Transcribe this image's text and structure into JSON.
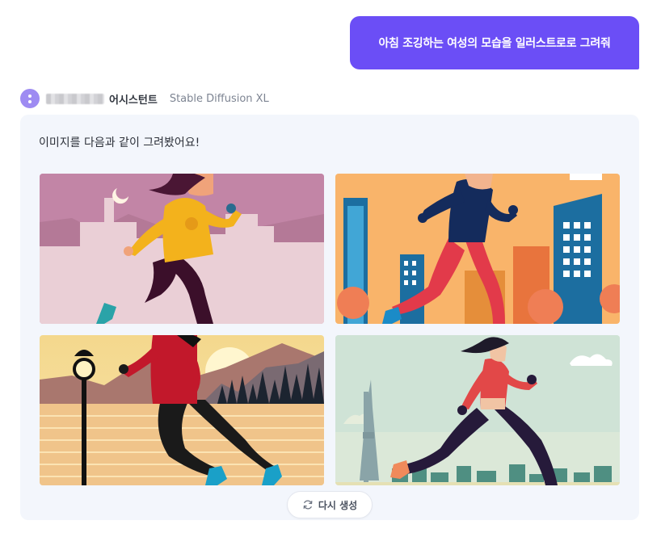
{
  "user_message": "아침 조깅하는 여성의 모습을 일러스트로로 그려줘",
  "assistant": {
    "name": "어시스턴트",
    "model": "Stable Diffusion XL",
    "avatar_icon": "assistant-avatar-icon"
  },
  "answer": {
    "text": "이미지를 다음과 같이 그려봤어요!",
    "images": [
      {
        "icon": "woman-jogging-night-city-illustration"
      },
      {
        "icon": "woman-jogging-city-autumn-illustration"
      },
      {
        "icon": "woman-jogging-lakeside-sunrise-illustration"
      },
      {
        "icon": "woman-jogging-skyline-tower-illustration"
      }
    ]
  },
  "regenerate": {
    "label": "다시 생성",
    "icon": "refresh-icon"
  },
  "colors": {
    "user_bubble": "#6b4ef6",
    "avatar": "#9e8bf2",
    "card_bg": "#f3f6fc"
  }
}
